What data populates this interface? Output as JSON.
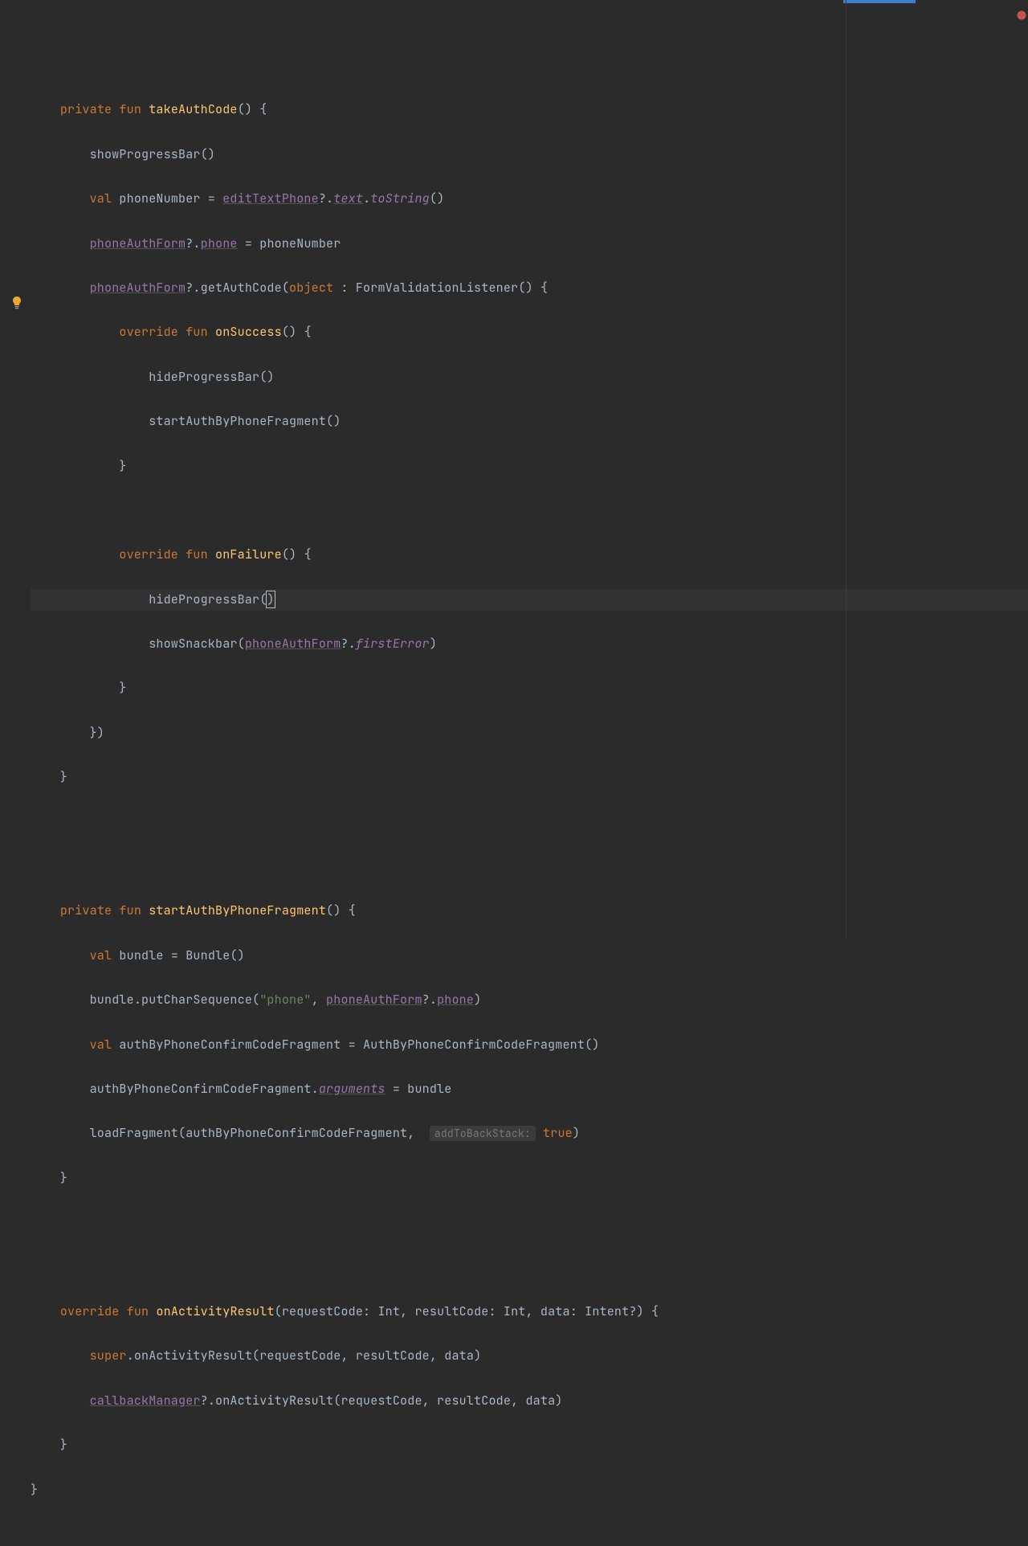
{
  "code": {
    "kw_private": "private",
    "kw_fun": "fun",
    "kw_val": "val",
    "kw_override": "override",
    "kw_object": "object",
    "kw_super": "super",
    "kw_true": "true",
    "fn_takeAuthCode": "takeAuthCode",
    "fn_onSuccess": "onSuccess",
    "fn_onFailure": "onFailure",
    "fn_startAuthByPhoneFragment": "startAuthByPhoneFragment",
    "fn_onActivityResult": "onActivityResult",
    "id_showProgressBar": "showProgressBar()",
    "id_hideProgressBar_open": "hideProgressBar(",
    "id_hideProgressBar": "hideProgressBar()",
    "id_startAuthByPhoneFragmentCall": "startAuthByPhoneFragment()",
    "id_phoneNumber": "phoneNumber",
    "id_editTextPhone": "editTextPhone",
    "id_text": "text",
    "id_toString": "toString",
    "id_phoneAuthForm": "phoneAuthForm",
    "id_phone": "phone",
    "id_getAuthCode": "getAuthCode",
    "id_FormValidationListener": "FormValidationListener",
    "id_showSnackbar": "showSnackbar",
    "id_firstError": "firstError",
    "id_bundle": "bundle",
    "id_Bundle": "Bundle",
    "id_putCharSequence": "putCharSequence",
    "str_phone": "\"phone\"",
    "id_authByPhoneConfirmCodeFragment": "authByPhoneConfirmCodeFragment",
    "id_AuthByPhoneConfirmCodeFragment": "AuthByPhoneConfirmCodeFragment",
    "id_arguments": "arguments",
    "id_loadFragment": "loadFragment",
    "hint_addToBackStack": "addToBackStack:",
    "id_requestCode": "requestCode",
    "id_resultCode": "resultCode",
    "id_data": "data",
    "id_Int": "Int",
    "id_Intent": "Intent",
    "id_callbackManager": "callbackManager",
    "id_onActivityResultCall": "onActivityResult"
  }
}
